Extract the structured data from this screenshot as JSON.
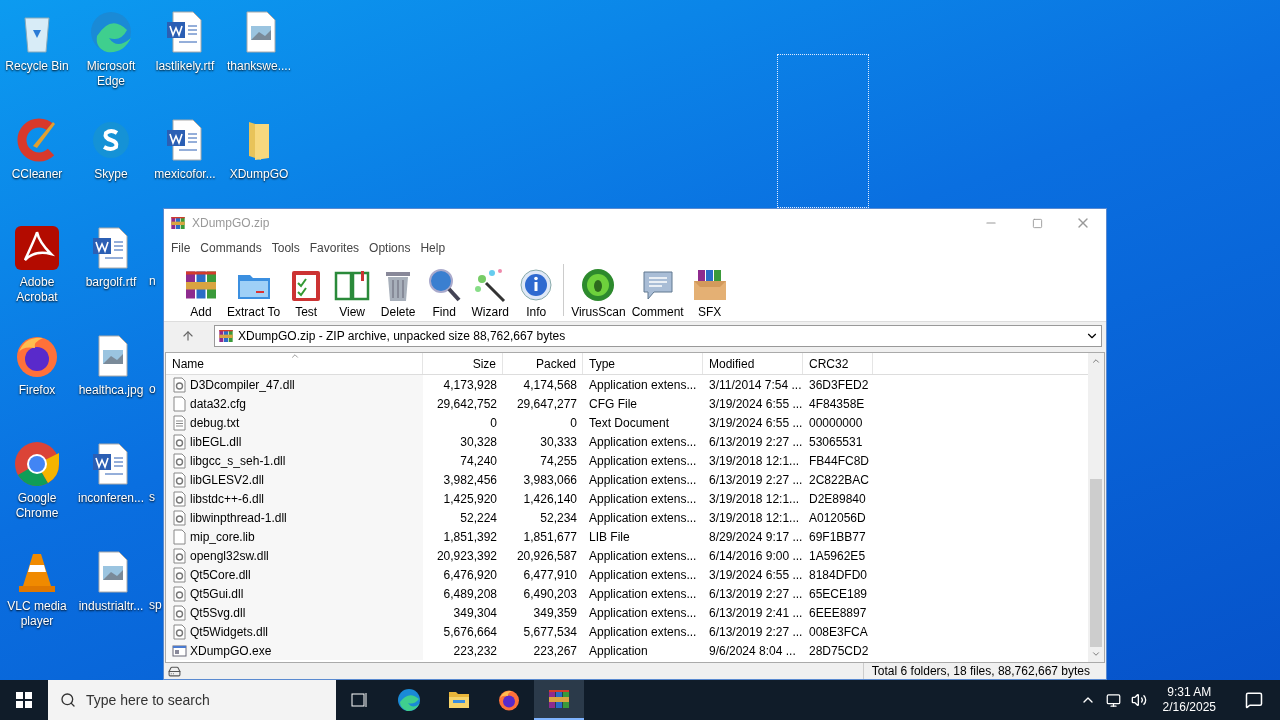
{
  "desktop": {
    "columns": [
      [
        {
          "label": "Recycle Bin",
          "kind": "recycle"
        },
        {
          "label": "CCleaner",
          "kind": "ccleaner"
        },
        {
          "label": "Adobe Acrobat",
          "kind": "acrobat"
        },
        {
          "label": "Firefox",
          "kind": "firefox"
        },
        {
          "label": "Google Chrome",
          "kind": "chrome"
        },
        {
          "label": "VLC media player",
          "kind": "vlc"
        }
      ],
      [
        {
          "label": "Microsoft Edge",
          "kind": "edge"
        },
        {
          "label": "Skype",
          "kind": "skype"
        },
        {
          "label": "bargolf.rtf",
          "kind": "word"
        },
        {
          "label": "healthca.jpg",
          "kind": "image"
        },
        {
          "label": "inconferen...",
          "kind": "word"
        },
        {
          "label": "industrialtr...",
          "kind": "image"
        }
      ],
      [
        {
          "label": "lastlikely.rtf",
          "kind": "word"
        },
        {
          "label": "mexicofor...",
          "kind": "word"
        },
        {
          "label": "n",
          "kind": "covered"
        },
        {
          "label": "o",
          "kind": "covered"
        },
        {
          "label": "s",
          "kind": "covered"
        },
        {
          "label": "sp",
          "kind": "covered"
        }
      ],
      [
        {
          "label": "thankswe....",
          "kind": "image"
        },
        {
          "label": "XDumpGO",
          "kind": "folder"
        }
      ]
    ]
  },
  "window": {
    "title": "XDumpGO.zip",
    "menu": [
      "File",
      "Commands",
      "Tools",
      "Favorites",
      "Options",
      "Help"
    ],
    "toolbar": [
      {
        "label": "Add",
        "kind": "add"
      },
      {
        "label": "Extract To",
        "kind": "extract"
      },
      {
        "label": "Test",
        "kind": "test"
      },
      {
        "label": "View",
        "kind": "view"
      },
      {
        "label": "Delete",
        "kind": "delete"
      },
      {
        "label": "Find",
        "kind": "find"
      },
      {
        "label": "Wizard",
        "kind": "wizard"
      },
      {
        "label": "Info",
        "kind": "info"
      },
      {
        "label": "VirusScan",
        "kind": "virus"
      },
      {
        "label": "Comment",
        "kind": "comment"
      },
      {
        "label": "SFX",
        "kind": "sfx"
      }
    ],
    "address": "XDumpGO.zip - ZIP archive, unpacked size 88,762,667 bytes",
    "table": {
      "columns": [
        "Name",
        "Size",
        "Packed",
        "Type",
        "Modified",
        "CRC32"
      ],
      "rows": [
        {
          "kind": "dll",
          "cells": [
            "D3Dcompiler_47.dll",
            "4,173,928",
            "4,174,568",
            "Application extens...",
            "3/11/2014 7:54 ...",
            "36D3FED2"
          ]
        },
        {
          "kind": "file",
          "cells": [
            "data32.cfg",
            "29,642,752",
            "29,647,277",
            "CFG File",
            "3/19/2024 6:55 ...",
            "4F84358E"
          ]
        },
        {
          "kind": "text",
          "cells": [
            "debug.txt",
            "0",
            "0",
            "Text Document",
            "3/19/2024 6:55 ...",
            "00000000"
          ]
        },
        {
          "kind": "dll",
          "cells": [
            "libEGL.dll",
            "30,328",
            "30,333",
            "Application extens...",
            "6/13/2019 2:27 ...",
            "53065531"
          ]
        },
        {
          "kind": "dll",
          "cells": [
            "libgcc_s_seh-1.dll",
            "74,240",
            "74,255",
            "Application extens...",
            "3/19/2018 12:1...",
            "FB44FC8D"
          ]
        },
        {
          "kind": "dll",
          "cells": [
            "libGLESV2.dll",
            "3,982,456",
            "3,983,066",
            "Application extens...",
            "6/13/2019 2:27 ...",
            "2C822BAC"
          ]
        },
        {
          "kind": "dll",
          "cells": [
            "libstdc++-6.dll",
            "1,425,920",
            "1,426,140",
            "Application extens...",
            "3/19/2018 12:1...",
            "D2E89840"
          ]
        },
        {
          "kind": "dll",
          "cells": [
            "libwinpthread-1.dll",
            "52,224",
            "52,234",
            "Application extens...",
            "3/19/2018 12:1...",
            "A012056D"
          ]
        },
        {
          "kind": "file",
          "cells": [
            "mip_core.lib",
            "1,851,392",
            "1,851,677",
            "LIB File",
            "8/29/2024 9:17 ...",
            "69F1BB77"
          ]
        },
        {
          "kind": "dll",
          "cells": [
            "opengl32sw.dll",
            "20,923,392",
            "20,926,587",
            "Application extens...",
            "6/14/2016 9:00 ...",
            "1A5962E5"
          ]
        },
        {
          "kind": "dll",
          "cells": [
            "Qt5Core.dll",
            "6,476,920",
            "6,477,910",
            "Application extens...",
            "3/19/2024 6:55 ...",
            "8184DFD0"
          ]
        },
        {
          "kind": "dll",
          "cells": [
            "Qt5Gui.dll",
            "6,489,208",
            "6,490,203",
            "Application extens...",
            "6/13/2019 2:27 ...",
            "65ECE189"
          ]
        },
        {
          "kind": "dll",
          "cells": [
            "Qt5Svg.dll",
            "349,304",
            "349,359",
            "Application extens...",
            "6/13/2019 2:41 ...",
            "6EEE8897"
          ]
        },
        {
          "kind": "dll",
          "cells": [
            "Qt5Widgets.dll",
            "5,676,664",
            "5,677,534",
            "Application extens...",
            "6/13/2019 2:27 ...",
            "008E3FCA"
          ]
        },
        {
          "kind": "exe",
          "cells": [
            "XDumpGO.exe",
            "223,232",
            "223,267",
            "Application",
            "9/6/2024 8:04 ...",
            "28D75CD2"
          ]
        }
      ]
    },
    "status": "Total 6 folders, 18 files, 88,762,667 bytes"
  },
  "taskbar": {
    "search": {
      "placeholder": "Type here to search"
    },
    "apps": [
      {
        "kind": "edge",
        "selected": false
      },
      {
        "kind": "explorer",
        "selected": false
      },
      {
        "kind": "firefox",
        "selected": false
      },
      {
        "kind": "winrar",
        "selected": true
      }
    ],
    "time": "9:31 AM",
    "date": "2/16/2025"
  }
}
